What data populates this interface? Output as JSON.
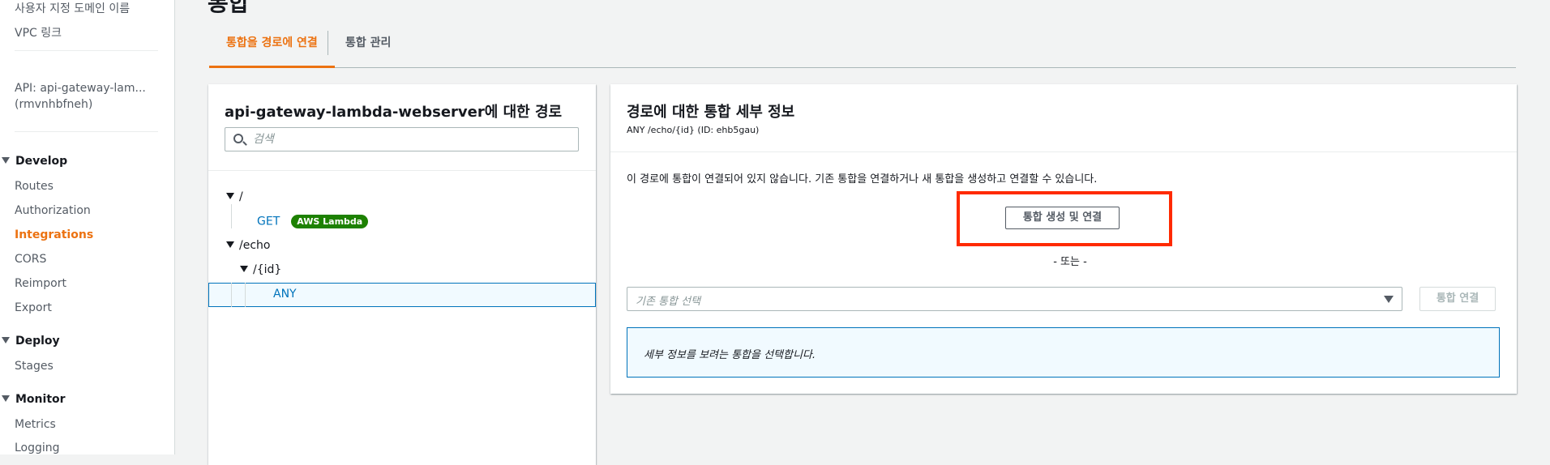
{
  "sidebar": {
    "custom_domain": "사용자 지정 도메인 이름",
    "vpc_link": "VPC 링크",
    "api_line1": "API: api-gateway-lam...",
    "api_line2": "(rmvnhbfneh)",
    "sections": [
      {
        "label": "Develop",
        "items": [
          "Routes",
          "Authorization",
          "Integrations",
          "CORS",
          "Reimport",
          "Export"
        ]
      },
      {
        "label": "Deploy",
        "items": [
          "Stages"
        ]
      },
      {
        "label": "Monitor",
        "items": [
          "Metrics",
          "Logging"
        ]
      }
    ],
    "active_item": "Integrations",
    "colors": {
      "active": "#ec7211"
    }
  },
  "main": {
    "page_title": "통합",
    "tabs": [
      {
        "label": "통합을 경로에 연결",
        "active": true
      },
      {
        "label": "통합 관리",
        "active": false
      }
    ]
  },
  "routes_panel": {
    "title": "api-gateway-lambda-webserver에 대한 경로",
    "search_placeholder": "검색",
    "tree": {
      "root": "/",
      "root_method": "GET",
      "root_badge": "AWS Lambda",
      "echo": "/echo",
      "id": "/{id}",
      "id_method": "ANY"
    }
  },
  "details_panel": {
    "title": "경로에 대한 통합 세부 정보",
    "subtitle": "ANY /echo/{id} (ID: ehb5gau)",
    "message": "이 경로에 통합이 연결되어 있지 않습니다. 기존 통합을 연결하거나 새 통합을 생성하고 연결할 수 있습니다.",
    "create_button": "통합 생성 및 연결",
    "or_text": "- 또는 -",
    "select_placeholder": "기존 통합 선택",
    "attach_button": "통합 연결",
    "info_text": "세부 정보를 보려는 통합을 선택합니다.",
    "colors": {
      "highlight": "#ff2a00",
      "badge": "#1d8102",
      "link": "#0073bb"
    }
  }
}
